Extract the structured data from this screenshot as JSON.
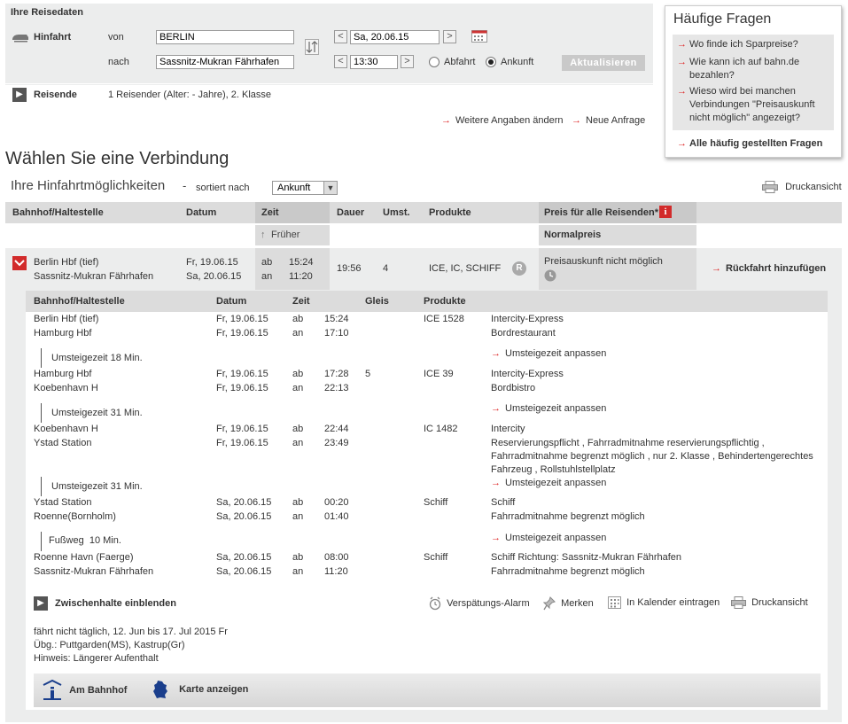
{
  "reisedaten": {
    "title": "Ihre Reisedaten",
    "hinfahrt_label": "Hinfahrt",
    "von_label": "von",
    "nach_label": "nach",
    "von_value": "BERLIN",
    "nach_value": "Sassnitz-Mukran Fährhafen",
    "date_value": "Sa, 20.06.15",
    "time_value": "13:30",
    "abfahrt_label": "Abfahrt",
    "ankunft_label": "Ankunft",
    "selected_mode": "Ankunft",
    "update_button": "Aktualisieren",
    "reisende_label": "Reisende",
    "reisende_value": "1 Reisender (Alter: - Jahre), 2. Klasse",
    "weitere_link": "Weitere Angaben ändern",
    "neue_link": "Neue Anfrage"
  },
  "faq": {
    "title": "Häufige Fragen",
    "items": [
      "Wo finde ich Sparpreise?",
      "Wie kann ich auf bahn.de bezahlen?",
      "Wieso wird bei manchen Verbindungen \"Preisauskunft nicht möglich\" angezeigt?"
    ],
    "all_link": "Alle häufig gestellten Fragen"
  },
  "results": {
    "heading": "Wählen Sie eine Verbindung",
    "subheading": "Ihre Hinfahrtmöglichkeiten",
    "dash": "-",
    "sort_label": "sortiert nach",
    "sort_value": "Ankunft",
    "print_view": "Druckansicht",
    "columns": {
      "station": "Bahnhof/Haltestelle",
      "date": "Datum",
      "time": "Zeit",
      "duration": "Dauer",
      "changes": "Umst.",
      "products": "Produkte",
      "price": "Preis für alle Reisenden*"
    },
    "earlier": "Früher",
    "normalpreis": "Normalpreis",
    "connection": {
      "from": "Berlin Hbf (tief)",
      "to": "Sassnitz-Mukran Fährhafen",
      "date_dep": "Fr, 19.06.15",
      "date_arr": "Sa, 20.06.15",
      "ab": "ab",
      "an": "an",
      "time_dep": "15:24",
      "time_arr": "11:20",
      "duration": "19:56",
      "changes": "4",
      "products": "ICE, IC, SCHIFF",
      "reservation_badge": "R",
      "price_text": "Preisauskunft nicht möglich",
      "return_link": "Rückfahrt hinzufügen"
    }
  },
  "details": {
    "columns": {
      "station": "Bahnhof/Haltestelle",
      "date": "Datum",
      "time": "Zeit",
      "track": "Gleis",
      "products": "Produkte"
    },
    "adjust_label": "Umsteigezeit anpassen",
    "legs": [
      {
        "dep_station": "Berlin Hbf (tief)",
        "arr_station": "Hamburg Hbf",
        "dep_date": "Fr, 19.06.15",
        "arr_date": "Fr, 19.06.15",
        "dep_time": "15:24",
        "arr_time": "17:10",
        "dep_track": "",
        "arr_track": "",
        "train": "ICE 1528",
        "info1": "Intercity-Express",
        "info2": "Bordrestaurant",
        "info3": "",
        "info4": ""
      },
      {
        "dep_station": "Hamburg Hbf",
        "arr_station": "Koebenhavn H",
        "dep_date": "Fr, 19.06.15",
        "arr_date": "Fr, 19.06.15",
        "dep_time": "17:28",
        "arr_time": "22:13",
        "dep_track": "5",
        "arr_track": "",
        "train": "ICE 39",
        "info1": "Intercity-Express",
        "info2": "Bordbistro",
        "info3": "",
        "info4": ""
      },
      {
        "dep_station": "Koebenhavn H",
        "arr_station": "Ystad Station",
        "dep_date": "Fr, 19.06.15",
        "arr_date": "Fr, 19.06.15",
        "dep_time": "22:44",
        "arr_time": "23:49",
        "dep_track": "",
        "arr_track": "",
        "train": "IC 1482",
        "info1": "Intercity",
        "info2": "Reservierungspflicht , Fahrradmitnahme reservierungspflichtig ,",
        "info3": "Fahrradmitnahme begrenzt möglich , nur 2. Klasse , Behindertengerechtes",
        "info4": "Fahrzeug , Rollstuhlstellplatz"
      },
      {
        "dep_station": "Ystad Station",
        "arr_station": "Roenne(Bornholm)",
        "dep_date": "Sa, 20.06.15",
        "arr_date": "Sa, 20.06.15",
        "dep_time": "00:20",
        "arr_time": "01:40",
        "dep_track": "",
        "arr_track": "",
        "train": "Schiff",
        "info1": "Schiff",
        "info2": "Fahrradmitnahme begrenzt möglich",
        "info3": "",
        "info4": ""
      },
      {
        "dep_station": "Roenne Havn (Faerge)",
        "arr_station": "Sassnitz-Mukran Fährhafen",
        "dep_date": "Sa, 20.06.15",
        "arr_date": "Sa, 20.06.15",
        "dep_time": "08:00",
        "arr_time": "11:20",
        "dep_track": "",
        "arr_track": "",
        "train": "Schiff",
        "info1": "Schiff Richtung: Sassnitz-Mukran Fährhafen",
        "info2": "Fahrradmitnahme begrenzt möglich",
        "info3": "",
        "info4": ""
      }
    ],
    "transfers": [
      "Umsteigezeit 18 Min.",
      "Umsteigezeit 31 Min.",
      "Umsteigezeit 31 Min.",
      "Fußweg  10 Min."
    ],
    "show_stops": "Zwischenhalte einblenden",
    "actions": {
      "alarm": "Verspätungs-Alarm",
      "merken": "Merken",
      "kalender": "In Kalender eintragen",
      "druck": "Druckansicht"
    },
    "notes": [
      "fährt nicht täglich, 12. Jun bis 17. Jul 2015 Fr",
      "Übg.: Puttgarden(MS), Kastrup(Gr)",
      "Hinweis: Längerer Aufenthalt"
    ],
    "footer": {
      "am_bahnhof": "Am Bahnhof",
      "karte": "Karte anzeigen"
    }
  },
  "colors": {
    "accent_red": "#d22b2b",
    "panel_gray": "#eceded",
    "header_gray": "#dcdcdc",
    "button_gray": "#c9c9c9"
  },
  "icons": [
    "train-icon",
    "swap-icon",
    "calendar-icon",
    "chevron-right-icon",
    "info-icon",
    "clock-icon",
    "alarm-icon",
    "pin-icon",
    "printer-icon",
    "station-info-icon",
    "germany-map-icon",
    "expand-icon"
  ]
}
